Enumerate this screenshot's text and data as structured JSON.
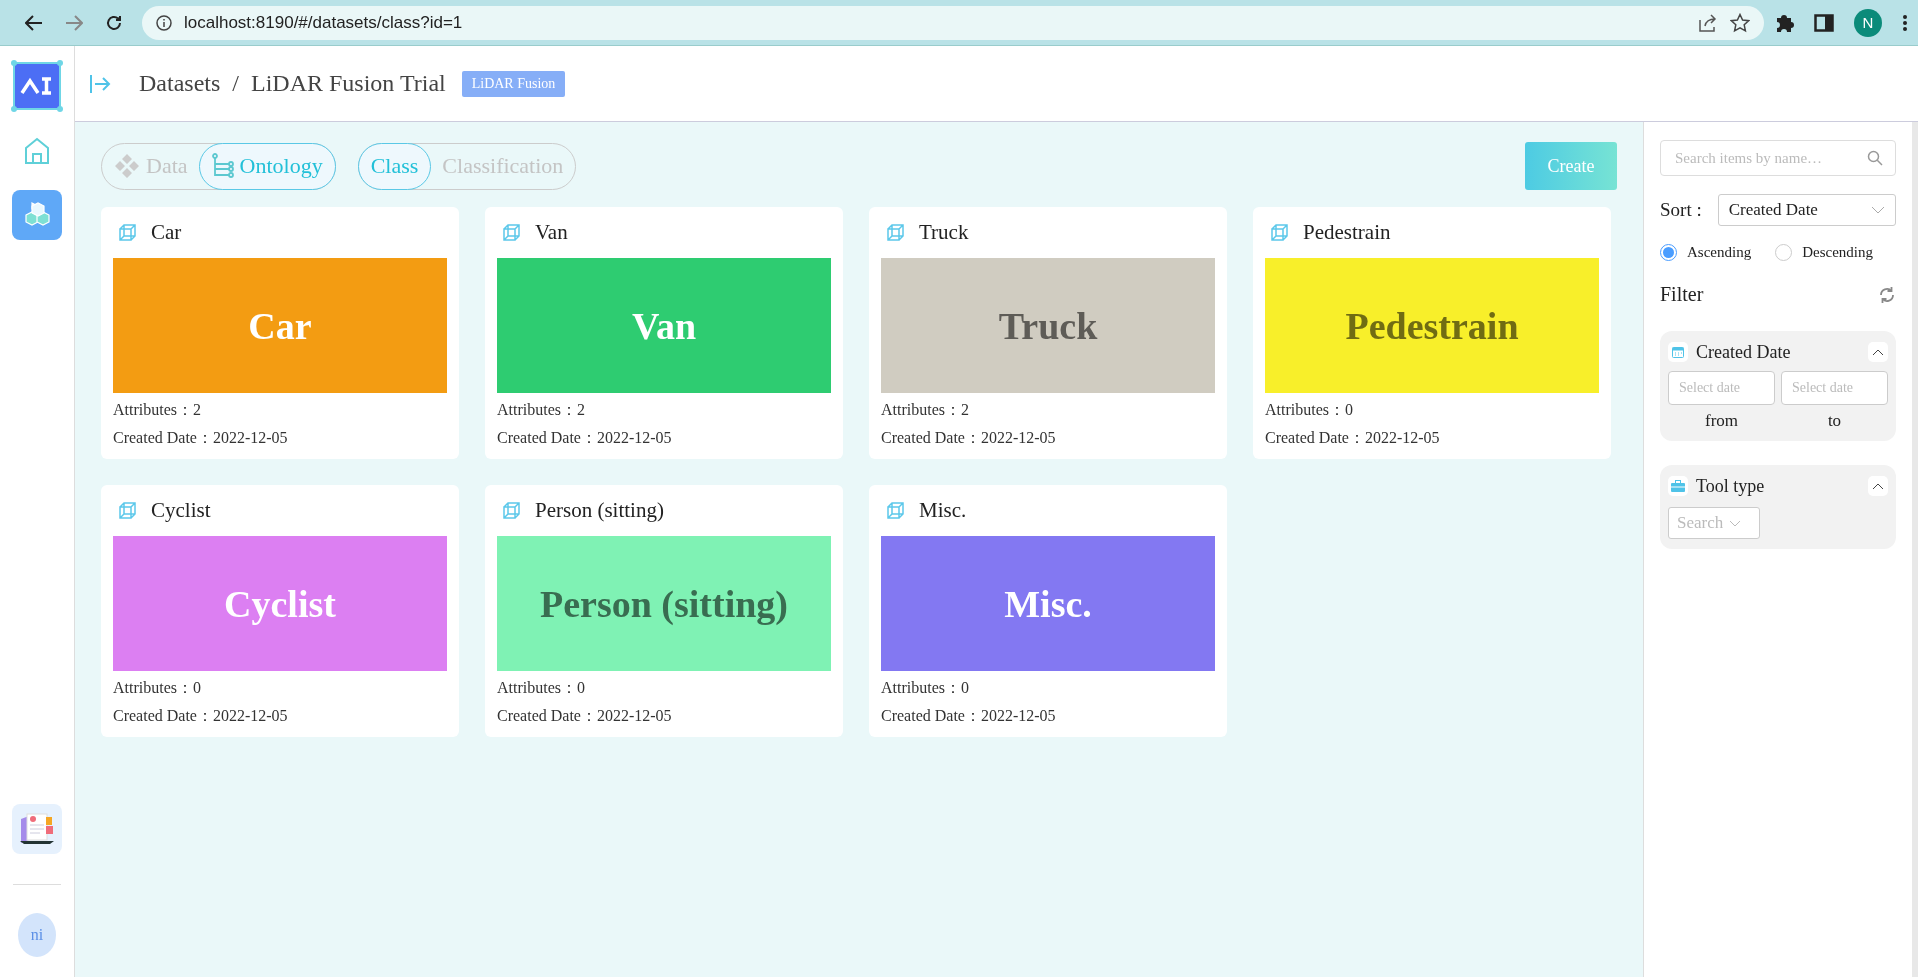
{
  "browser": {
    "url": "localhost:8190/#/datasets/class?id=1",
    "profile_initial": "N"
  },
  "sidebar": {
    "items": [
      {
        "kind": "home",
        "selected": false
      },
      {
        "kind": "datasets",
        "selected": true
      }
    ],
    "avatar": "ni"
  },
  "header": {
    "breadcrumb": [
      "Datasets",
      "/",
      "LiDAR Fusion Trial"
    ],
    "badge": "LiDAR Fusion"
  },
  "tabs": [
    {
      "kind": "data",
      "label": "Data",
      "selected": false
    },
    {
      "kind": "ontology",
      "label": "Ontology",
      "selected": true
    }
  ],
  "subtabs": [
    {
      "label": "Class",
      "selected": true
    },
    {
      "label": "Classification",
      "selected": false
    }
  ],
  "create_button": "Create",
  "classes": [
    {
      "name": "Car",
      "preview_text": "Car",
      "color": "#f39c12",
      "attributes": "Attributes：2",
      "created": "Created Date：2022-12-05"
    },
    {
      "name": "Van",
      "preview_text": "Van",
      "color": "#2ecc71",
      "attributes": "Attributes：2",
      "created": "Created Date：2022-12-05"
    },
    {
      "name": "Truck",
      "preview_text": "Truck",
      "color": "#d0ccc1",
      "attributes": "Attributes：2",
      "created": "Created Date：2022-12-05"
    },
    {
      "name": "Pedestrain",
      "preview_text": "Pedestrain",
      "color": "#f8ef2a",
      "attributes": "Attributes：0",
      "created": "Created Date：2022-12-05"
    },
    {
      "name": "Cyclist",
      "preview_text": "Cyclist",
      "color": "#dc7ff2",
      "attributes": "Attributes：0",
      "created": "Created Date：2022-12-05"
    },
    {
      "name": "Person (sitting)",
      "preview_text": "Person (sitting)",
      "color": "#7ff2b4",
      "attributes": "Attributes：0",
      "created": "Created Date：2022-12-05"
    },
    {
      "name": "Misc.",
      "preview_text": "Misc.",
      "color": "#8378f2",
      "attributes": "Attributes：0",
      "created": "Created Date：2022-12-05"
    }
  ],
  "panel": {
    "search": {
      "placeholder": "Search items by name…"
    },
    "sort": {
      "label": "Sort :",
      "value": "Created Date"
    },
    "order": [
      {
        "label": "Ascending",
        "selected": true
      },
      {
        "label": "Descending",
        "selected": false
      }
    ],
    "filter_title": "Filter",
    "sections": [
      {
        "kind": "date",
        "title": "Created Date",
        "expanded": true,
        "from_placeholder": "Select date",
        "to_placeholder": "Select date",
        "from_label": "from",
        "to_label": "to"
      },
      {
        "kind": "select",
        "title": "Tool type",
        "expanded": true,
        "placeholder": "Search"
      }
    ]
  }
}
